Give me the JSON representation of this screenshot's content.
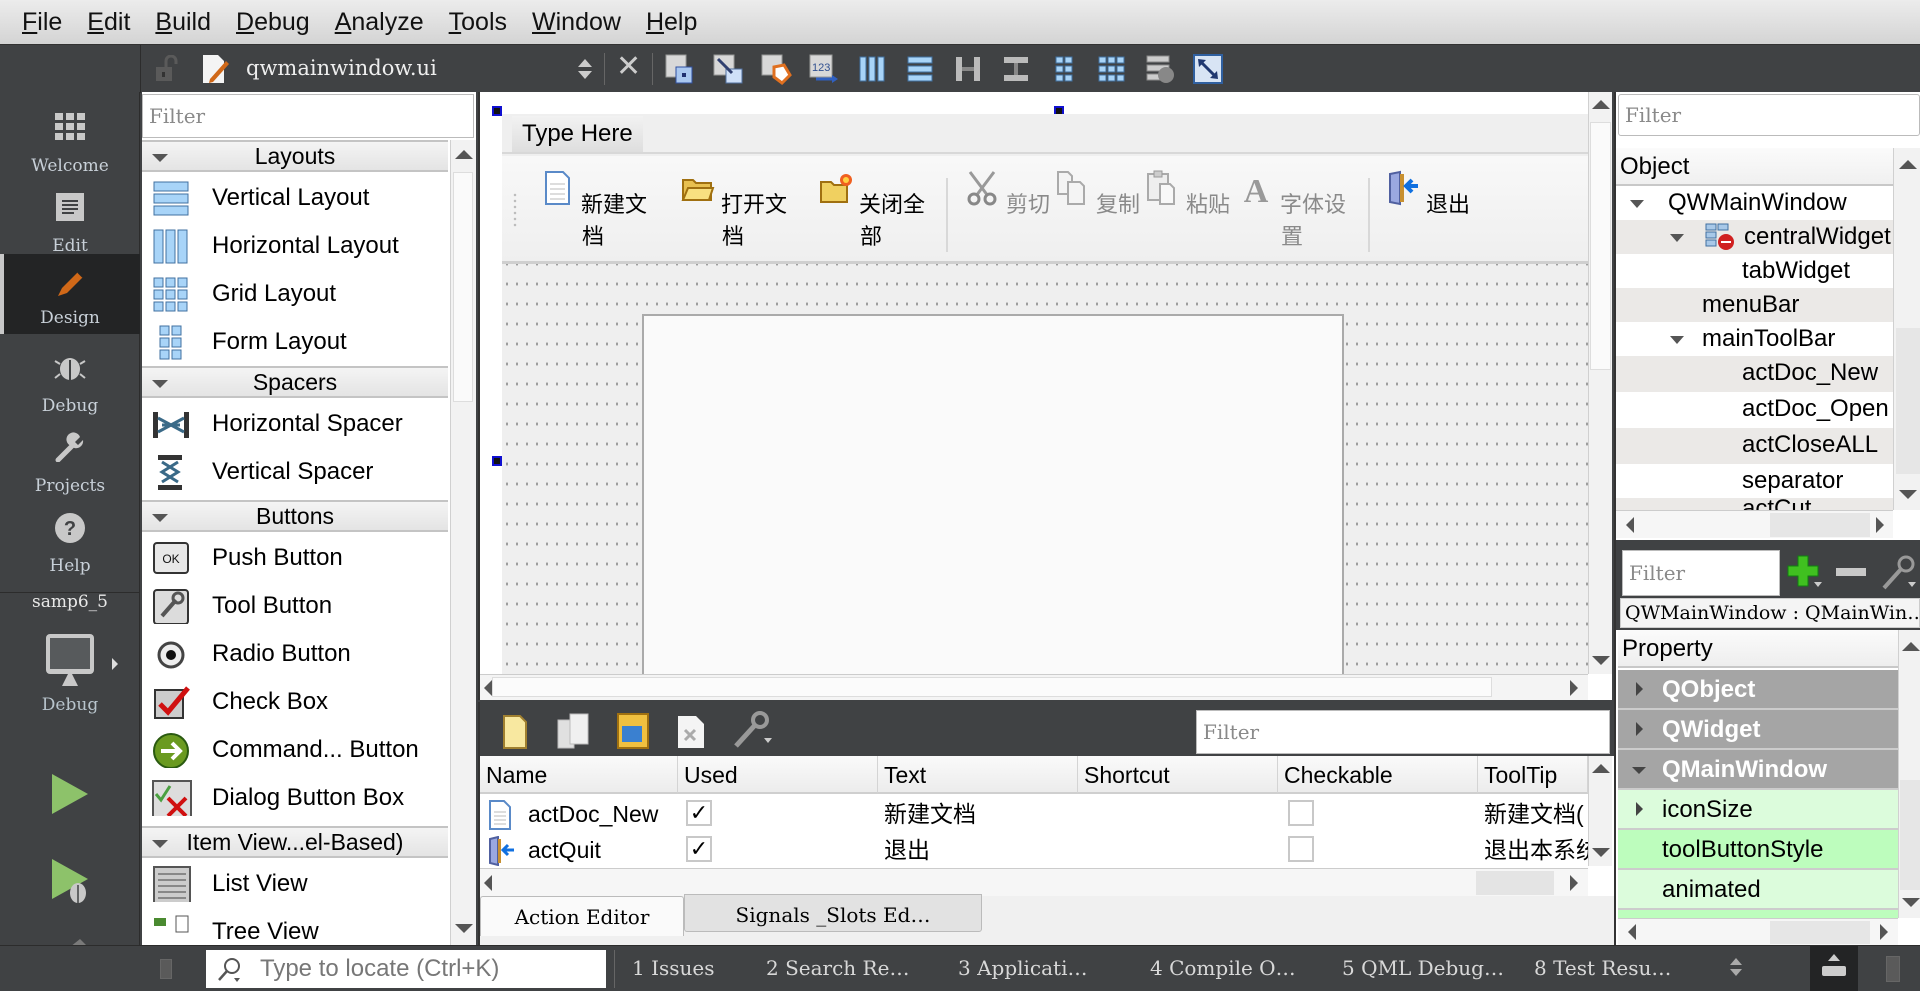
{
  "menubar": {
    "items": [
      {
        "label": "File",
        "mnemonic": "F",
        "rest": "ile"
      },
      {
        "label": "Edit",
        "mnemonic": "E",
        "rest": "dit"
      },
      {
        "label": "Build",
        "mnemonic": "B",
        "rest": "uild"
      },
      {
        "label": "Debug",
        "mnemonic": "D",
        "rest": "ebug"
      },
      {
        "label": "Analyze",
        "mnemonic": "A",
        "rest": "nalyze"
      },
      {
        "label": "Tools",
        "mnemonic": "T",
        "rest": "ools"
      },
      {
        "label": "Window",
        "mnemonic": "W",
        "rest": "indow"
      },
      {
        "label": "Help",
        "mnemonic": "H",
        "rest": "elp"
      }
    ]
  },
  "editor_toolbar": {
    "file_name": "qwmainwindow.ui",
    "icons": [
      "edit-widgets-icon",
      "edit-signals-slots-icon",
      "edit-buddies-icon",
      "edit-tab-order-icon",
      "layout-horizontal-icon",
      "layout-vertical-icon",
      "layout-horizontal-splitter-icon",
      "layout-vertical-splitter-icon",
      "layout-form-icon",
      "layout-grid-icon",
      "break-layout-icon",
      "adjust-size-icon"
    ]
  },
  "modebar": {
    "modes": [
      {
        "label": "Welcome",
        "icon": "grid-icon"
      },
      {
        "label": "Edit",
        "icon": "document-icon"
      },
      {
        "label": "Design",
        "icon": "pencil-icon",
        "active": true
      },
      {
        "label": "Debug",
        "icon": "bug-icon"
      },
      {
        "label": "Projects",
        "icon": "wrench-icon"
      },
      {
        "label": "Help",
        "icon": "help-icon"
      }
    ],
    "project": "samp6_5",
    "kit_label": "Debug"
  },
  "widgetbox": {
    "filter_placeholder": "Filter",
    "categories": [
      {
        "name": "Layouts",
        "items": [
          "Vertical Layout",
          "Horizontal Layout",
          "Grid Layout",
          "Form Layout"
        ]
      },
      {
        "name": "Spacers",
        "items": [
          "Horizontal Spacer",
          "Vertical Spacer"
        ]
      },
      {
        "name": "Buttons",
        "items": [
          "Push Button",
          "Tool Button",
          "Radio Button",
          "Check Box",
          "Command... Button",
          "Dialog Button Box"
        ]
      },
      {
        "name": "Item View...el-Based)",
        "items": [
          "List View",
          "Tree View"
        ]
      }
    ]
  },
  "form": {
    "menu_placeholder": "Type Here",
    "toolbar_actions": [
      {
        "label": "新建文档",
        "icon": "new-document-icon",
        "enabled": true
      },
      {
        "label": "打开文档",
        "icon": "open-folder-icon",
        "enabled": true
      },
      {
        "label": "关闭全部",
        "icon": "close-all-folder-icon",
        "enabled": true
      },
      {
        "separator": true
      },
      {
        "label": "剪切",
        "icon": "scissors-icon",
        "enabled": false
      },
      {
        "label": "复制",
        "icon": "copy-icon",
        "enabled": false
      },
      {
        "label": "粘贴",
        "icon": "paste-icon",
        "enabled": false
      },
      {
        "label": "字体设置",
        "icon": "font-icon",
        "enabled": false
      },
      {
        "separator": true
      },
      {
        "label": "退出",
        "icon": "exit-door-icon",
        "enabled": true
      }
    ]
  },
  "action_editor": {
    "filter_placeholder": "Filter",
    "columns": [
      "Name",
      "Used",
      "Text",
      "Shortcut",
      "Checkable",
      "ToolTip"
    ],
    "rows": [
      {
        "name": "actDoc_New",
        "icon": "new-document-icon",
        "used": true,
        "text": "新建文档",
        "shortcut": "",
        "checkable": false,
        "tooltip": "新建文档("
      },
      {
        "name": "actQuit",
        "icon": "exit-door-icon",
        "used": true,
        "text": "退出",
        "shortcut": "",
        "checkable": false,
        "tooltip": "退出本系统"
      }
    ],
    "tabs": [
      {
        "label": "Action Editor",
        "active": true
      },
      {
        "label": "Signals _Slots Ed…",
        "active": false
      }
    ]
  },
  "object_inspector": {
    "filter_placeholder": "Filter",
    "header": "Object",
    "tree": [
      {
        "label": "QWMainWindow",
        "depth": 0,
        "expanded": true
      },
      {
        "label": "centralWidget",
        "depth": 1,
        "expanded": true,
        "icon": "broken-layout-icon"
      },
      {
        "label": "tabWidget",
        "depth": 2
      },
      {
        "label": "menuBar",
        "depth": 1
      },
      {
        "label": "mainToolBar",
        "depth": 1,
        "expanded": true
      },
      {
        "label": "actDoc_New",
        "depth": 2
      },
      {
        "label": "actDoc_Open",
        "depth": 2
      },
      {
        "label": "actCloseALL",
        "depth": 2
      },
      {
        "label": "separator",
        "depth": 2
      },
      {
        "label": "actCut",
        "depth": 2
      }
    ]
  },
  "property_editor": {
    "filter_placeholder": "Filter",
    "object_class": "QWMainWindow : QMainWin…",
    "header": "Property",
    "rows": [
      {
        "label": "QObject",
        "type": "group",
        "expanded": false
      },
      {
        "label": "QWidget",
        "type": "group",
        "expanded": false
      },
      {
        "label": "QMainWindow",
        "type": "group",
        "expanded": true
      },
      {
        "label": "iconSize",
        "type": "prop",
        "expandable": true
      },
      {
        "label": "toolButtonStyle",
        "type": "prop"
      },
      {
        "label": "animated",
        "type": "prop"
      }
    ]
  },
  "statusbar": {
    "locator_placeholder": "Type to locate (Ctrl+K)",
    "panes": [
      "1  Issues",
      "2  Search Re…",
      "3  Applicati…",
      "4  Compile O…",
      "5  QML Debug…",
      "8  Test Resu…"
    ]
  }
}
